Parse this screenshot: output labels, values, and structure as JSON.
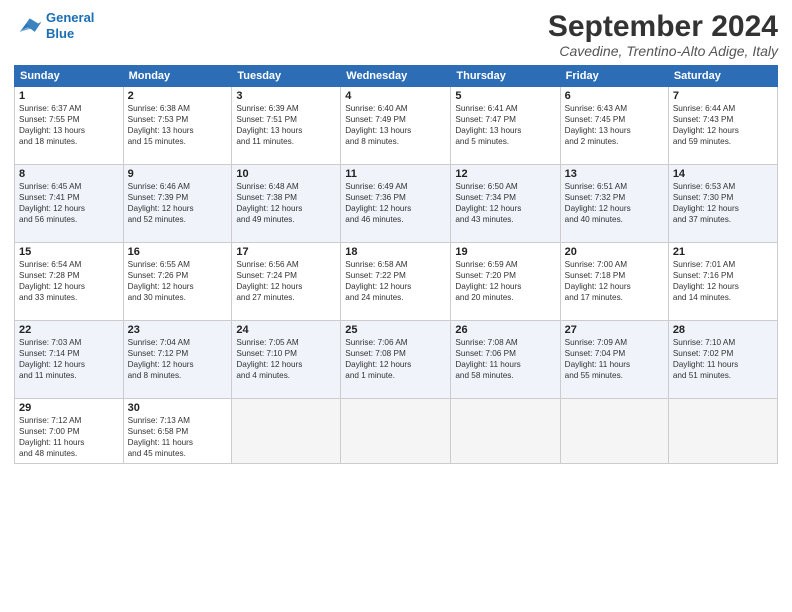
{
  "logo": {
    "line1": "General",
    "line2": "Blue"
  },
  "title": "September 2024",
  "subtitle": "Cavedine, Trentino-Alto Adige, Italy",
  "headers": [
    "Sunday",
    "Monday",
    "Tuesday",
    "Wednesday",
    "Thursday",
    "Friday",
    "Saturday"
  ],
  "weeks": [
    [
      {
        "day": "1",
        "info": "Sunrise: 6:37 AM\nSunset: 7:55 PM\nDaylight: 13 hours\nand 18 minutes."
      },
      {
        "day": "2",
        "info": "Sunrise: 6:38 AM\nSunset: 7:53 PM\nDaylight: 13 hours\nand 15 minutes."
      },
      {
        "day": "3",
        "info": "Sunrise: 6:39 AM\nSunset: 7:51 PM\nDaylight: 13 hours\nand 11 minutes."
      },
      {
        "day": "4",
        "info": "Sunrise: 6:40 AM\nSunset: 7:49 PM\nDaylight: 13 hours\nand 8 minutes."
      },
      {
        "day": "5",
        "info": "Sunrise: 6:41 AM\nSunset: 7:47 PM\nDaylight: 13 hours\nand 5 minutes."
      },
      {
        "day": "6",
        "info": "Sunrise: 6:43 AM\nSunset: 7:45 PM\nDaylight: 13 hours\nand 2 minutes."
      },
      {
        "day": "7",
        "info": "Sunrise: 6:44 AM\nSunset: 7:43 PM\nDaylight: 12 hours\nand 59 minutes."
      }
    ],
    [
      {
        "day": "8",
        "info": "Sunrise: 6:45 AM\nSunset: 7:41 PM\nDaylight: 12 hours\nand 56 minutes."
      },
      {
        "day": "9",
        "info": "Sunrise: 6:46 AM\nSunset: 7:39 PM\nDaylight: 12 hours\nand 52 minutes."
      },
      {
        "day": "10",
        "info": "Sunrise: 6:48 AM\nSunset: 7:38 PM\nDaylight: 12 hours\nand 49 minutes."
      },
      {
        "day": "11",
        "info": "Sunrise: 6:49 AM\nSunset: 7:36 PM\nDaylight: 12 hours\nand 46 minutes."
      },
      {
        "day": "12",
        "info": "Sunrise: 6:50 AM\nSunset: 7:34 PM\nDaylight: 12 hours\nand 43 minutes."
      },
      {
        "day": "13",
        "info": "Sunrise: 6:51 AM\nSunset: 7:32 PM\nDaylight: 12 hours\nand 40 minutes."
      },
      {
        "day": "14",
        "info": "Sunrise: 6:53 AM\nSunset: 7:30 PM\nDaylight: 12 hours\nand 37 minutes."
      }
    ],
    [
      {
        "day": "15",
        "info": "Sunrise: 6:54 AM\nSunset: 7:28 PM\nDaylight: 12 hours\nand 33 minutes."
      },
      {
        "day": "16",
        "info": "Sunrise: 6:55 AM\nSunset: 7:26 PM\nDaylight: 12 hours\nand 30 minutes."
      },
      {
        "day": "17",
        "info": "Sunrise: 6:56 AM\nSunset: 7:24 PM\nDaylight: 12 hours\nand 27 minutes."
      },
      {
        "day": "18",
        "info": "Sunrise: 6:58 AM\nSunset: 7:22 PM\nDaylight: 12 hours\nand 24 minutes."
      },
      {
        "day": "19",
        "info": "Sunrise: 6:59 AM\nSunset: 7:20 PM\nDaylight: 12 hours\nand 20 minutes."
      },
      {
        "day": "20",
        "info": "Sunrise: 7:00 AM\nSunset: 7:18 PM\nDaylight: 12 hours\nand 17 minutes."
      },
      {
        "day": "21",
        "info": "Sunrise: 7:01 AM\nSunset: 7:16 PM\nDaylight: 12 hours\nand 14 minutes."
      }
    ],
    [
      {
        "day": "22",
        "info": "Sunrise: 7:03 AM\nSunset: 7:14 PM\nDaylight: 12 hours\nand 11 minutes."
      },
      {
        "day": "23",
        "info": "Sunrise: 7:04 AM\nSunset: 7:12 PM\nDaylight: 12 hours\nand 8 minutes."
      },
      {
        "day": "24",
        "info": "Sunrise: 7:05 AM\nSunset: 7:10 PM\nDaylight: 12 hours\nand 4 minutes."
      },
      {
        "day": "25",
        "info": "Sunrise: 7:06 AM\nSunset: 7:08 PM\nDaylight: 12 hours\nand 1 minute."
      },
      {
        "day": "26",
        "info": "Sunrise: 7:08 AM\nSunset: 7:06 PM\nDaylight: 11 hours\nand 58 minutes."
      },
      {
        "day": "27",
        "info": "Sunrise: 7:09 AM\nSunset: 7:04 PM\nDaylight: 11 hours\nand 55 minutes."
      },
      {
        "day": "28",
        "info": "Sunrise: 7:10 AM\nSunset: 7:02 PM\nDaylight: 11 hours\nand 51 minutes."
      }
    ],
    [
      {
        "day": "29",
        "info": "Sunrise: 7:12 AM\nSunset: 7:00 PM\nDaylight: 11 hours\nand 48 minutes."
      },
      {
        "day": "30",
        "info": "Sunrise: 7:13 AM\nSunset: 6:58 PM\nDaylight: 11 hours\nand 45 minutes."
      },
      {
        "day": "",
        "info": ""
      },
      {
        "day": "",
        "info": ""
      },
      {
        "day": "",
        "info": ""
      },
      {
        "day": "",
        "info": ""
      },
      {
        "day": "",
        "info": ""
      }
    ]
  ]
}
